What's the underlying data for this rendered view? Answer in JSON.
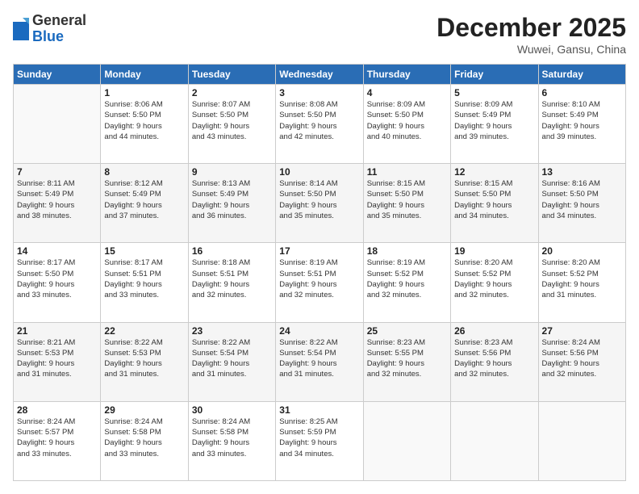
{
  "header": {
    "logo_general": "General",
    "logo_blue": "Blue",
    "month_title": "December 2025",
    "location": "Wuwei, Gansu, China"
  },
  "days_of_week": [
    "Sunday",
    "Monday",
    "Tuesday",
    "Wednesday",
    "Thursday",
    "Friday",
    "Saturday"
  ],
  "weeks": [
    [
      {
        "day": "",
        "info": ""
      },
      {
        "day": "1",
        "info": "Sunrise: 8:06 AM\nSunset: 5:50 PM\nDaylight: 9 hours\nand 44 minutes."
      },
      {
        "day": "2",
        "info": "Sunrise: 8:07 AM\nSunset: 5:50 PM\nDaylight: 9 hours\nand 43 minutes."
      },
      {
        "day": "3",
        "info": "Sunrise: 8:08 AM\nSunset: 5:50 PM\nDaylight: 9 hours\nand 42 minutes."
      },
      {
        "day": "4",
        "info": "Sunrise: 8:09 AM\nSunset: 5:50 PM\nDaylight: 9 hours\nand 40 minutes."
      },
      {
        "day": "5",
        "info": "Sunrise: 8:09 AM\nSunset: 5:49 PM\nDaylight: 9 hours\nand 39 minutes."
      },
      {
        "day": "6",
        "info": "Sunrise: 8:10 AM\nSunset: 5:49 PM\nDaylight: 9 hours\nand 39 minutes."
      }
    ],
    [
      {
        "day": "7",
        "info": "Sunrise: 8:11 AM\nSunset: 5:49 PM\nDaylight: 9 hours\nand 38 minutes."
      },
      {
        "day": "8",
        "info": "Sunrise: 8:12 AM\nSunset: 5:49 PM\nDaylight: 9 hours\nand 37 minutes."
      },
      {
        "day": "9",
        "info": "Sunrise: 8:13 AM\nSunset: 5:49 PM\nDaylight: 9 hours\nand 36 minutes."
      },
      {
        "day": "10",
        "info": "Sunrise: 8:14 AM\nSunset: 5:50 PM\nDaylight: 9 hours\nand 35 minutes."
      },
      {
        "day": "11",
        "info": "Sunrise: 8:15 AM\nSunset: 5:50 PM\nDaylight: 9 hours\nand 35 minutes."
      },
      {
        "day": "12",
        "info": "Sunrise: 8:15 AM\nSunset: 5:50 PM\nDaylight: 9 hours\nand 34 minutes."
      },
      {
        "day": "13",
        "info": "Sunrise: 8:16 AM\nSunset: 5:50 PM\nDaylight: 9 hours\nand 34 minutes."
      }
    ],
    [
      {
        "day": "14",
        "info": "Sunrise: 8:17 AM\nSunset: 5:50 PM\nDaylight: 9 hours\nand 33 minutes."
      },
      {
        "day": "15",
        "info": "Sunrise: 8:17 AM\nSunset: 5:51 PM\nDaylight: 9 hours\nand 33 minutes."
      },
      {
        "day": "16",
        "info": "Sunrise: 8:18 AM\nSunset: 5:51 PM\nDaylight: 9 hours\nand 32 minutes."
      },
      {
        "day": "17",
        "info": "Sunrise: 8:19 AM\nSunset: 5:51 PM\nDaylight: 9 hours\nand 32 minutes."
      },
      {
        "day": "18",
        "info": "Sunrise: 8:19 AM\nSunset: 5:52 PM\nDaylight: 9 hours\nand 32 minutes."
      },
      {
        "day": "19",
        "info": "Sunrise: 8:20 AM\nSunset: 5:52 PM\nDaylight: 9 hours\nand 32 minutes."
      },
      {
        "day": "20",
        "info": "Sunrise: 8:20 AM\nSunset: 5:52 PM\nDaylight: 9 hours\nand 31 minutes."
      }
    ],
    [
      {
        "day": "21",
        "info": "Sunrise: 8:21 AM\nSunset: 5:53 PM\nDaylight: 9 hours\nand 31 minutes."
      },
      {
        "day": "22",
        "info": "Sunrise: 8:22 AM\nSunset: 5:53 PM\nDaylight: 9 hours\nand 31 minutes."
      },
      {
        "day": "23",
        "info": "Sunrise: 8:22 AM\nSunset: 5:54 PM\nDaylight: 9 hours\nand 31 minutes."
      },
      {
        "day": "24",
        "info": "Sunrise: 8:22 AM\nSunset: 5:54 PM\nDaylight: 9 hours\nand 31 minutes."
      },
      {
        "day": "25",
        "info": "Sunrise: 8:23 AM\nSunset: 5:55 PM\nDaylight: 9 hours\nand 32 minutes."
      },
      {
        "day": "26",
        "info": "Sunrise: 8:23 AM\nSunset: 5:56 PM\nDaylight: 9 hours\nand 32 minutes."
      },
      {
        "day": "27",
        "info": "Sunrise: 8:24 AM\nSunset: 5:56 PM\nDaylight: 9 hours\nand 32 minutes."
      }
    ],
    [
      {
        "day": "28",
        "info": "Sunrise: 8:24 AM\nSunset: 5:57 PM\nDaylight: 9 hours\nand 33 minutes."
      },
      {
        "day": "29",
        "info": "Sunrise: 8:24 AM\nSunset: 5:58 PM\nDaylight: 9 hours\nand 33 minutes."
      },
      {
        "day": "30",
        "info": "Sunrise: 8:24 AM\nSunset: 5:58 PM\nDaylight: 9 hours\nand 33 minutes."
      },
      {
        "day": "31",
        "info": "Sunrise: 8:25 AM\nSunset: 5:59 PM\nDaylight: 9 hours\nand 34 minutes."
      },
      {
        "day": "",
        "info": ""
      },
      {
        "day": "",
        "info": ""
      },
      {
        "day": "",
        "info": ""
      }
    ]
  ]
}
